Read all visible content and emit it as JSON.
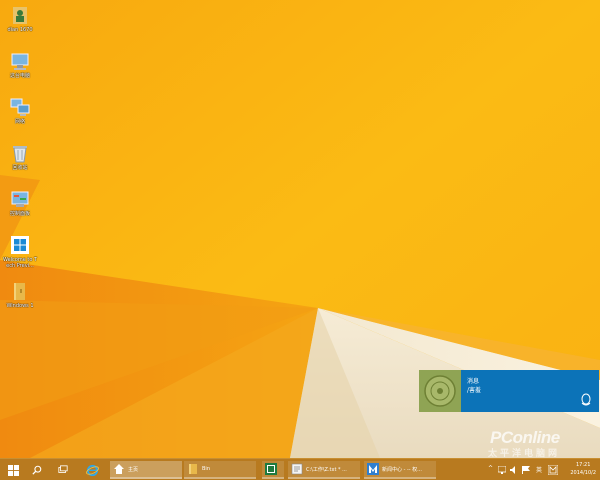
{
  "desktop": {
    "icons": [
      {
        "name": "user-folder",
        "label": "dian 1670",
        "icon": "user-folder-icon"
      },
      {
        "name": "computer",
        "label": "这台电脑",
        "icon": "computer-icon"
      },
      {
        "name": "network",
        "label": "网络",
        "icon": "network-icon"
      },
      {
        "name": "recycle-bin",
        "label": "回收站",
        "icon": "recycle-bin-icon"
      },
      {
        "name": "control-panel",
        "label": "控制面板",
        "icon": "control-panel-icon"
      },
      {
        "name": "welcome",
        "label": "Welcome to Tech Previ...",
        "icon": "windows-icon"
      },
      {
        "name": "folder",
        "label": "Windows 1",
        "icon": "folder-icon"
      }
    ]
  },
  "toast": {
    "title": "消息",
    "body": "/害羞",
    "logo": "qq-penguin-icon",
    "color": "#0c73b8"
  },
  "watermark": {
    "main": "PConline",
    "sub": "太平洋电脑网"
  },
  "taskbar": {
    "start_icon": "windows-start-icon",
    "search_icon": "search-icon",
    "taskview_icon": "task-view-icon",
    "ie_icon": "internet-explorer-icon",
    "tasks": [
      {
        "name": "home",
        "label": "主页",
        "icon": "home-icon",
        "active": true
      },
      {
        "name": "bin",
        "label": "Bin",
        "icon": "folder-icon",
        "active": false
      },
      {
        "name": "excel",
        "label": "",
        "icon": "excel-icon",
        "active": false
      },
      {
        "name": "notepad",
        "label": "C:\\工作\\Z.txt * ...",
        "icon": "notepad-icon",
        "active": false
      },
      {
        "name": "news",
        "label": "新闻中心 - -- 权...",
        "icon": "news-app-icon",
        "active": false
      }
    ],
    "tray": {
      "chevron": "^",
      "keyboard": "英",
      "clock_time": "17:21",
      "clock_date": "2014/10/2"
    }
  }
}
